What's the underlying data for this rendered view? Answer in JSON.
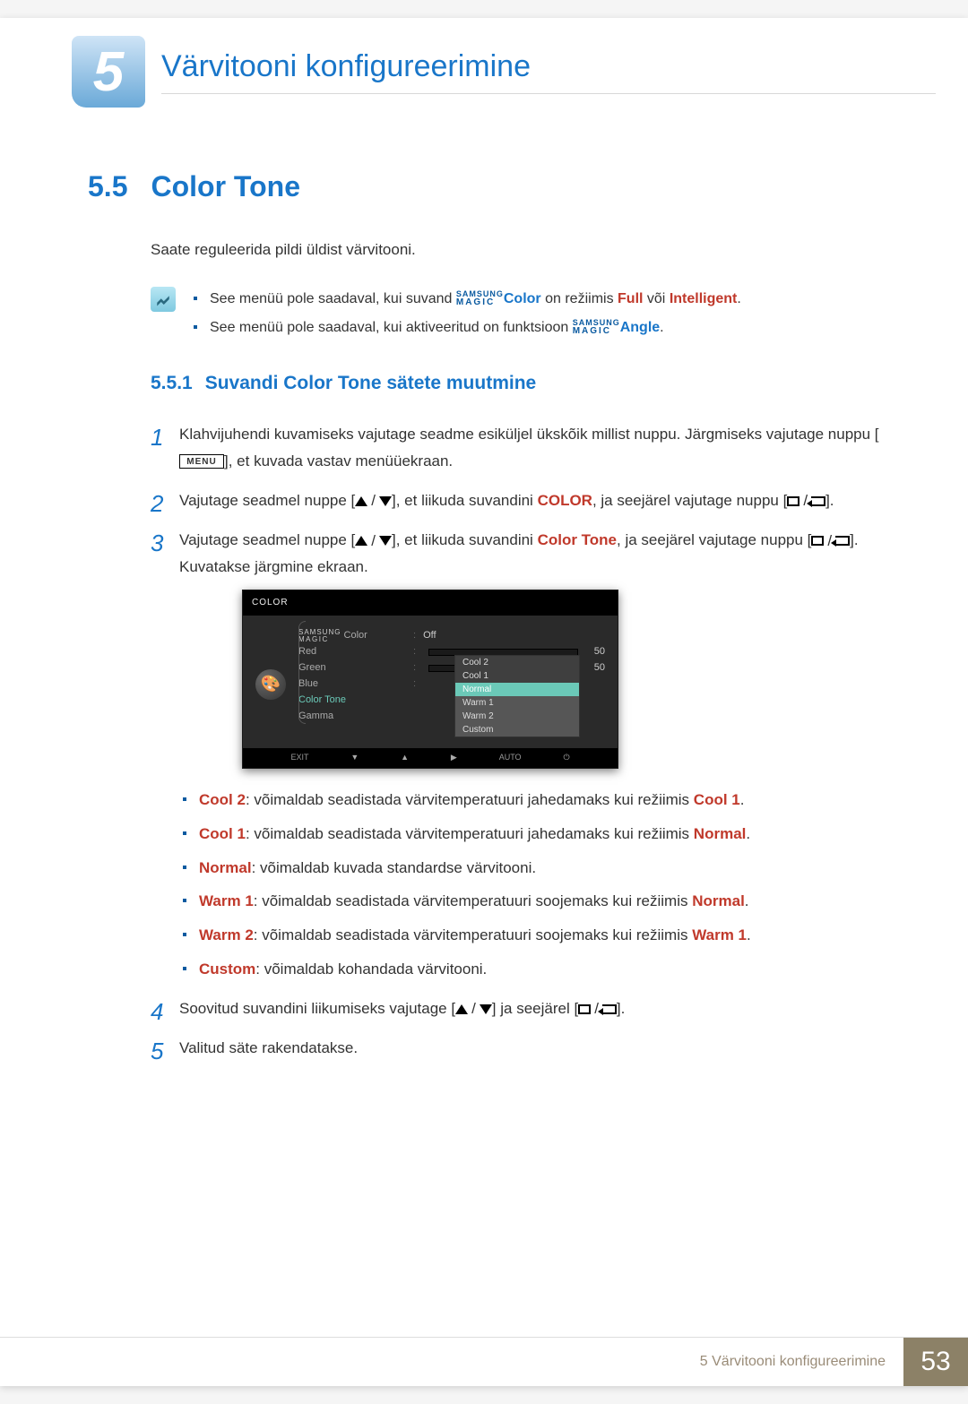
{
  "chapter": {
    "num": "5",
    "title": "Värvitooni konfigureerimine"
  },
  "section": {
    "num": "5.5",
    "title": "Color Tone"
  },
  "intro": "Saate reguleerida pildi üldist värvitooni.",
  "notes": {
    "n1a": "See menüü pole saadaval, kui suvand ",
    "n1b": "Color",
    "n1c": " on režiimis ",
    "n1d": "Full",
    "n1e": " või ",
    "n1f": "Intelligent",
    "n1g": ".",
    "n2a": "See menüü pole saadaval, kui aktiveeritud on funktsioon ",
    "n2b": "Angle",
    "n2c": "."
  },
  "magic": {
    "top": "SAMSUNG",
    "bot": "MAGIC"
  },
  "subsection": {
    "num": "5.5.1",
    "title": "Suvandi Color Tone sätete muutmine"
  },
  "steps": {
    "s1a": "Klahvijuhendi kuvamiseks vajutage seadme esiküljel ükskõik millist nuppu. Järgmiseks vajutage nuppu [",
    "s1b": "], et kuvada vastav menüüekraan.",
    "menu": "MENU",
    "s2a": "Vajutage seadmel nuppe [",
    "s2b": "], et liikuda suvandini ",
    "s2c": "COLOR",
    "s2d": ", ja seejärel vajutage nuppu [",
    "s2e": "].",
    "s3a": "Vajutage seadmel nuppe [",
    "s3b": "], et liikuda suvandini ",
    "s3c": "Color Tone",
    "s3d": ", ja seejärel vajutage nuppu [",
    "s3e": "]. Kuvatakse järgmine ekraan.",
    "s4a": "Soovitud suvandini liikumiseks vajutage [",
    "s4b": "] ja seejärel [",
    "s4c": "].",
    "s5": "Valitud säte rakendatakse."
  },
  "osd": {
    "header": "COLOR",
    "items": {
      "magic_color": "Color",
      "red": "Red",
      "green": "Green",
      "blue": "Blue",
      "color_tone": "Color Tone",
      "gamma": "Gamma"
    },
    "off": "Off",
    "val50a": "50",
    "val50b": "50",
    "tone_opts": [
      "Cool 2",
      "Cool 1",
      "Normal",
      "Warm 1",
      "Warm 2",
      "Custom"
    ],
    "footer": {
      "exit": "EXIT",
      "auto": "AUTO"
    }
  },
  "opts": {
    "cool2": "Cool 2",
    "cool2_txt": ": võimaldab seadistada värvitemperatuuri jahedamaks kui režiimis ",
    "cool2_ref": "Cool 1",
    "cool1": "Cool 1",
    "cool1_txt": ": võimaldab seadistada värvitemperatuuri jahedamaks kui režiimis ",
    "cool1_ref": "Normal",
    "normal": "Normal",
    "normal_txt": ": võimaldab kuvada standardse värvitooni.",
    "warm1": "Warm 1",
    "warm1_txt": ": võimaldab seadistada värvitemperatuuri soojemaks kui režiimis ",
    "warm1_ref": "Normal",
    "warm2": "Warm 2",
    "warm2_txt": ": võimaldab seadistada värvitemperatuuri soojemaks kui režiimis ",
    "warm2_ref": "Warm 1",
    "custom": "Custom",
    "custom_txt": ": võimaldab kohandada värvitooni."
  },
  "footer": {
    "text": "5 Värvitooni konfigureerimine",
    "page": "53"
  }
}
